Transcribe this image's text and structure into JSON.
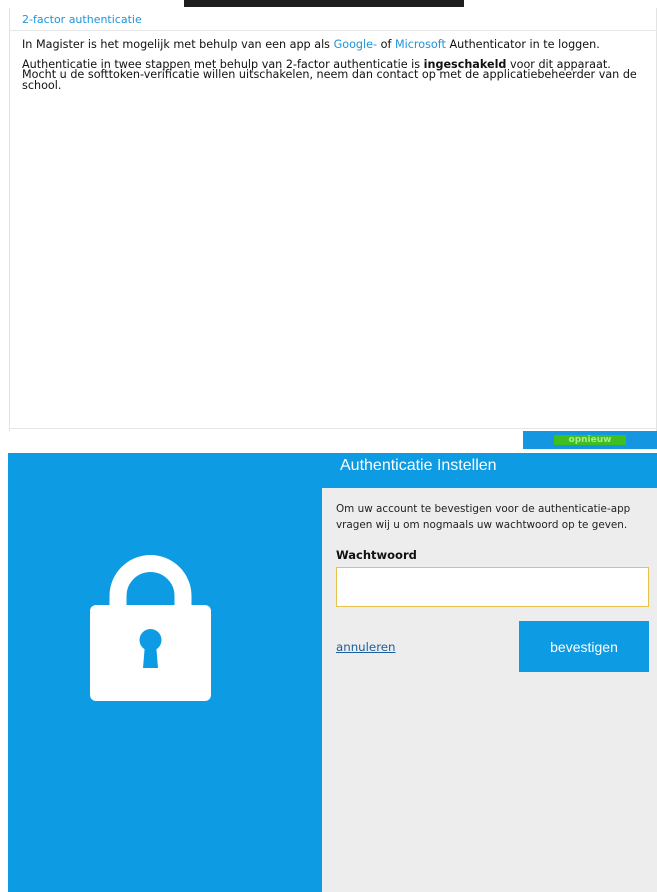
{
  "panel": {
    "title": "2-factor authenticatie",
    "intro": {
      "text1": "In Magister is het mogelijk met behulp van een app als ",
      "google": "Google-",
      "text2": " of ",
      "microsoft": "Microsoft",
      "text3": " Authenticator in te loggen.",
      "p2a": "Authenticatie in twee stappen met behulp van 2-factor authenticatie is ",
      "p2b": "ingeschakeld",
      "p2c": " voor dit apparaat. Mocht u de softtoken-verificatie willen uitschakelen, neem dan contact op met de applicatiebeheerder van de school."
    },
    "retry_label": "opnieuw"
  },
  "dialog": {
    "title": "Authenticatie Instellen",
    "description": "Om uw account te bevestigen voor de authenticatie-app vragen wij u om nogmaals uw wachtwoord op te geven.",
    "password_label": "Wachtwoord",
    "password_value": "",
    "cancel_label": "annuleren",
    "confirm_label": "bevestigen"
  },
  "icons": {
    "lock": "lock-icon"
  },
  "colors": {
    "accent": "#0d9be3",
    "link": "#1b94dc",
    "input_border": "#e8c24a",
    "retry_green": "#3fbf1f"
  }
}
